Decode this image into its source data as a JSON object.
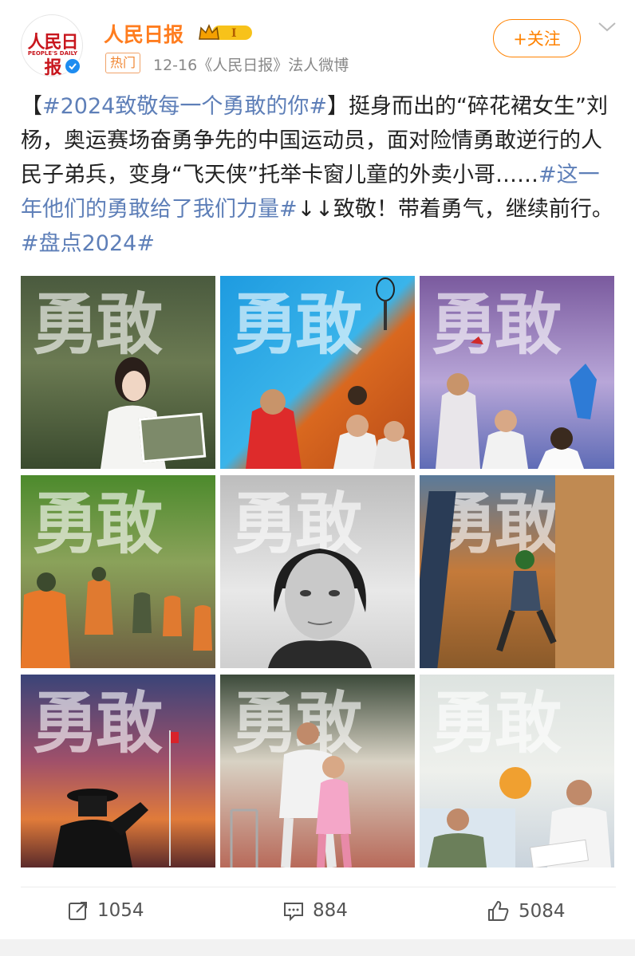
{
  "header": {
    "avatar_logo": "人民日报",
    "avatar_sub": "PEOPLE'S DAILY",
    "name": "人民日报",
    "badge_level": "I",
    "hot_tag": "热门",
    "meta": "12-16《人民日报》法人微博",
    "follow_label": "+关注"
  },
  "post": {
    "bracket_open": "【",
    "topic1": "#2024致敬每一个勇敢的你#",
    "bracket_close": "】",
    "text1": "挺身而出的“碎花裙女生”刘杨，奥运赛场奋勇争先的中国运动员，面对险情勇敢逆行的人民子弟兵，变身“飞天侠”托举卡窗儿童的外卖小哥……",
    "topic2": "#这一年他们的勇敢给了我们力量#",
    "text2": "↓↓致敬！带着勇气，继续前行。",
    "topic3": "#盘点2024#"
  },
  "images": [
    {
      "overlay": "勇敢"
    },
    {
      "overlay": "勇敢"
    },
    {
      "overlay": "勇敢"
    },
    {
      "overlay": "勇敢"
    },
    {
      "overlay": "勇敢"
    },
    {
      "overlay": "勇敢"
    },
    {
      "overlay": "勇敢"
    },
    {
      "overlay": "勇敢"
    },
    {
      "overlay": "勇敢"
    }
  ],
  "actions": {
    "repost_count": "1054",
    "comment_count": "884",
    "like_count": "5084"
  },
  "colors": {
    "brand_orange": "#ff8200",
    "topic_blue": "#5e7fb8",
    "name_orange": "#ff7d1f"
  }
}
